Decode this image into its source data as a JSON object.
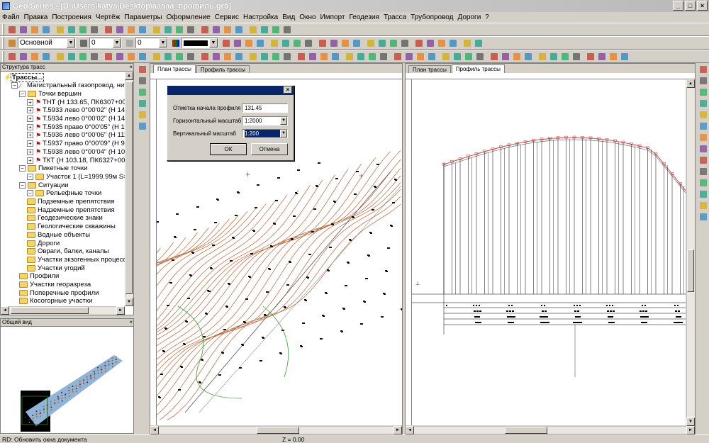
{
  "window": {
    "title": "Geo Series - [D:\\Users\\katya\\Desktop\\ааааа_профиль.grb]"
  },
  "menu": [
    "Файл",
    "Правка",
    "Построения",
    "Чертёж",
    "Параметры",
    "Оформление",
    "Сервис",
    "Настройка",
    "Вид",
    "Окно",
    "Импорт",
    "Геодезия",
    "Трасса",
    "Трубопровод",
    "Дороги",
    "?"
  ],
  "toolbar": {
    "layer_select": "Основной",
    "line_width_1": "0",
    "line_width_2": "0"
  },
  "tree_panel": {
    "title": "Структура трасс",
    "items": [
      {
        "label": "Трассы...",
        "level": 0,
        "bold": true
      },
      {
        "label": "Магистральный газопровод, нитка",
        "level": 1
      },
      {
        "label": "Точки вершин",
        "level": 2
      },
      {
        "label": "ТНТ (Н 133.65, ПК6307+00)",
        "level": 3
      },
      {
        "label": "Т.5933 лево 0°00'02\" (Н 142.4",
        "level": 3
      },
      {
        "label": "Т.5934 лево 0°00'02\" (Н 143.5",
        "level": 3
      },
      {
        "label": "Т.5935 право 0°00'05\" (Н 125",
        "level": 3
      },
      {
        "label": "Т.5936 лево 0°00'06\" (Н 111.3",
        "level": 3
      },
      {
        "label": "Т.5937 право 0°00'09\" (Н 92.7",
        "level": 3
      },
      {
        "label": "Т.5938 лево 0°00'04\" (Н 100.4",
        "level": 3
      },
      {
        "label": "ТКТ (Н 103.18, ПК6327+00)",
        "level": 3
      },
      {
        "label": "Пикетные точки",
        "level": 2
      },
      {
        "label": "Участок 1 (L=1999.99м S=100",
        "level": 3
      },
      {
        "label": "Ситуации",
        "level": 2
      },
      {
        "label": "Рельефные точки",
        "level": 3
      },
      {
        "label": "Подземные препятствия",
        "level": 3
      },
      {
        "label": "Надземные препятствия",
        "level": 3
      },
      {
        "label": "Геодезические знаки",
        "level": 3
      },
      {
        "label": "Геологические скважины",
        "level": 3
      },
      {
        "label": "Водные объекты",
        "level": 3
      },
      {
        "label": "Дороги",
        "level": 3
      },
      {
        "label": "Овраги, балки, каналы",
        "level": 3
      },
      {
        "label": "Участки экзогенных процессо",
        "level": 3
      },
      {
        "label": "Участки угодий",
        "level": 3
      },
      {
        "label": "Профили",
        "level": 2
      },
      {
        "label": "Участки георазреза",
        "level": 2
      },
      {
        "label": "Поперечные профили",
        "level": 2
      },
      {
        "label": "Косогорные участки",
        "level": 2
      }
    ]
  },
  "overview_panel": {
    "title": "Общий вид"
  },
  "left_doc": {
    "tabs": [
      "План трассы",
      "Профиль трассы"
    ],
    "active_tab": 0
  },
  "right_doc": {
    "tabs": [
      "План трассы",
      "Профиль трассы"
    ],
    "active_tab": 1
  },
  "dialog": {
    "fields": [
      {
        "label": "Отметка начала профиля",
        "value": "131.45",
        "dropdown": false
      },
      {
        "label": "Горизонтальный масштаб",
        "value": "1:2000",
        "dropdown": true
      },
      {
        "label": "Вертикальный масштаб",
        "value": "1:200",
        "dropdown": true,
        "selected": true
      }
    ],
    "ok_label": "ОК",
    "cancel_label": "Отмена"
  },
  "status": {
    "message": "RD: Обновить окна документа",
    "z": "Z = 0.00"
  }
}
